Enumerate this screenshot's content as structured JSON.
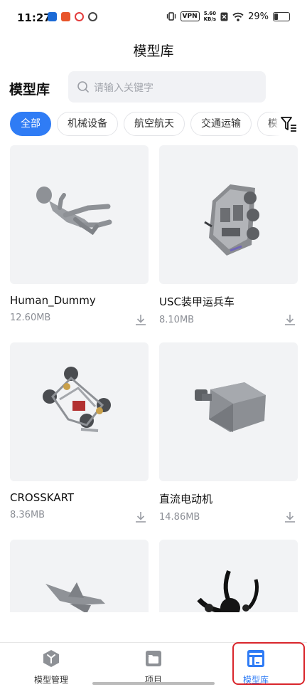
{
  "status_bar": {
    "time": "11:27",
    "vpn": "VPN",
    "net_speed_value": "5.60",
    "net_speed_unit": "KB/s",
    "battery": "29%",
    "app_icon_colors": [
      "#1b6ad6",
      "#e8542a",
      "#e33c3c",
      "#444444"
    ]
  },
  "header": {
    "title": "模型库"
  },
  "library": {
    "title": "模型库",
    "search_placeholder": "请输入关键字"
  },
  "categories": [
    {
      "label": "全部",
      "active": true
    },
    {
      "label": "机械设备",
      "active": false
    },
    {
      "label": "航空航天",
      "active": false
    },
    {
      "label": "交通运输",
      "active": false
    },
    {
      "label": "模具",
      "active": false
    }
  ],
  "models": [
    {
      "name": "Human_Dummy",
      "size": "12.60MB",
      "thumb_icon": "human-dummy-model"
    },
    {
      "name": "USC装甲运兵车",
      "size": "8.10MB",
      "thumb_icon": "armored-vehicle-model"
    },
    {
      "name": "CROSSKART",
      "size": "8.36MB",
      "thumb_icon": "crosskart-model"
    },
    {
      "name": "直流电动机",
      "size": "14.86MB",
      "thumb_icon": "dc-motor-model"
    },
    {
      "name": "",
      "size": "",
      "thumb_icon": "jet-aircraft-model"
    },
    {
      "name": "",
      "size": "",
      "thumb_icon": "dark-mechanism-model"
    }
  ],
  "nav": {
    "items": [
      {
        "label": "模型管理",
        "icon": "model-management-icon"
      },
      {
        "label": "项目",
        "icon": "project-icon"
      },
      {
        "label": "模型库",
        "icon": "model-library-icon",
        "active": true
      }
    ]
  },
  "colors": {
    "accent": "#2f7cf5",
    "highlight": "#d9262c"
  }
}
